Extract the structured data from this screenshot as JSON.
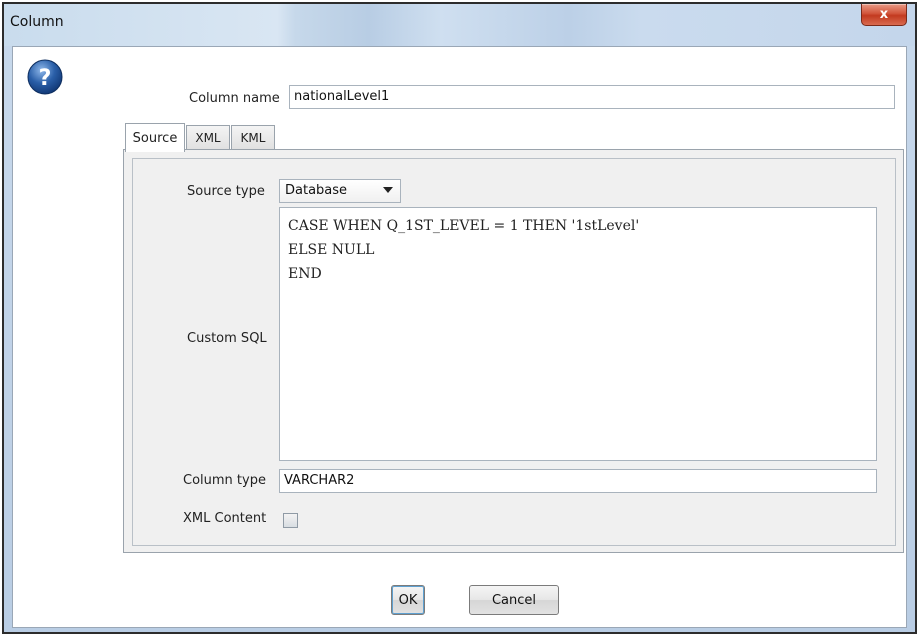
{
  "window": {
    "title": "Column",
    "close_label": "x"
  },
  "form": {
    "column_name_label": "Column name",
    "column_name_value": "nationalLevel1",
    "tabs": [
      {
        "label": "Source",
        "active": true
      },
      {
        "label": "XML",
        "active": false
      },
      {
        "label": "KML",
        "active": false
      }
    ],
    "source_type_label": "Source type",
    "source_type_value": "Database",
    "custom_sql_label": "Custom SQL",
    "custom_sql_value": "CASE WHEN Q_1ST_LEVEL = 1 THEN '1stLevel'\nELSE NULL\nEND",
    "column_type_label": "Column type",
    "column_type_value": "VARCHAR2",
    "xml_content_label": "XML Content",
    "xml_content_checked": false
  },
  "buttons": {
    "ok_label": "OK",
    "cancel_label": "Cancel"
  },
  "colors": {
    "help_icon": "#2a5fa8",
    "close_button": "#c9482d"
  },
  "icons": {
    "help": "question-icon",
    "close": "close-icon",
    "dropdown": "chevron-down-icon"
  }
}
